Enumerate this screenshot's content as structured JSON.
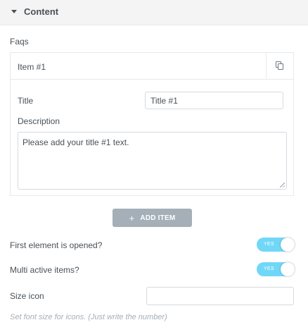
{
  "section": {
    "title": "Content"
  },
  "faqs": {
    "label": "Faqs",
    "items": [
      {
        "title": "Item #1",
        "fields": {
          "title_label": "Title",
          "title_value": "Title #1",
          "description_label": "Description",
          "description_value": "Please add your title #1 text."
        }
      }
    ],
    "add_item_label": "ADD ITEM"
  },
  "settings": {
    "first_opened": {
      "label": "First element is opened?",
      "state": "YES",
      "on": true
    },
    "multi_active": {
      "label": "Multi active items?",
      "state": "YES",
      "on": true
    },
    "size_icon": {
      "label": "Size icon",
      "value": "",
      "hint": "Set font size for icons. (Just write the number)"
    }
  },
  "colors": {
    "accent_switch": "#71d7f7",
    "button_bg": "#a4afb7",
    "header_bg": "#f4f4f4"
  },
  "icons": {
    "section_toggle": "caret-down-icon",
    "duplicate": "duplicate-icon",
    "add": "plus-icon",
    "resize": "resize-grip-icon"
  }
}
